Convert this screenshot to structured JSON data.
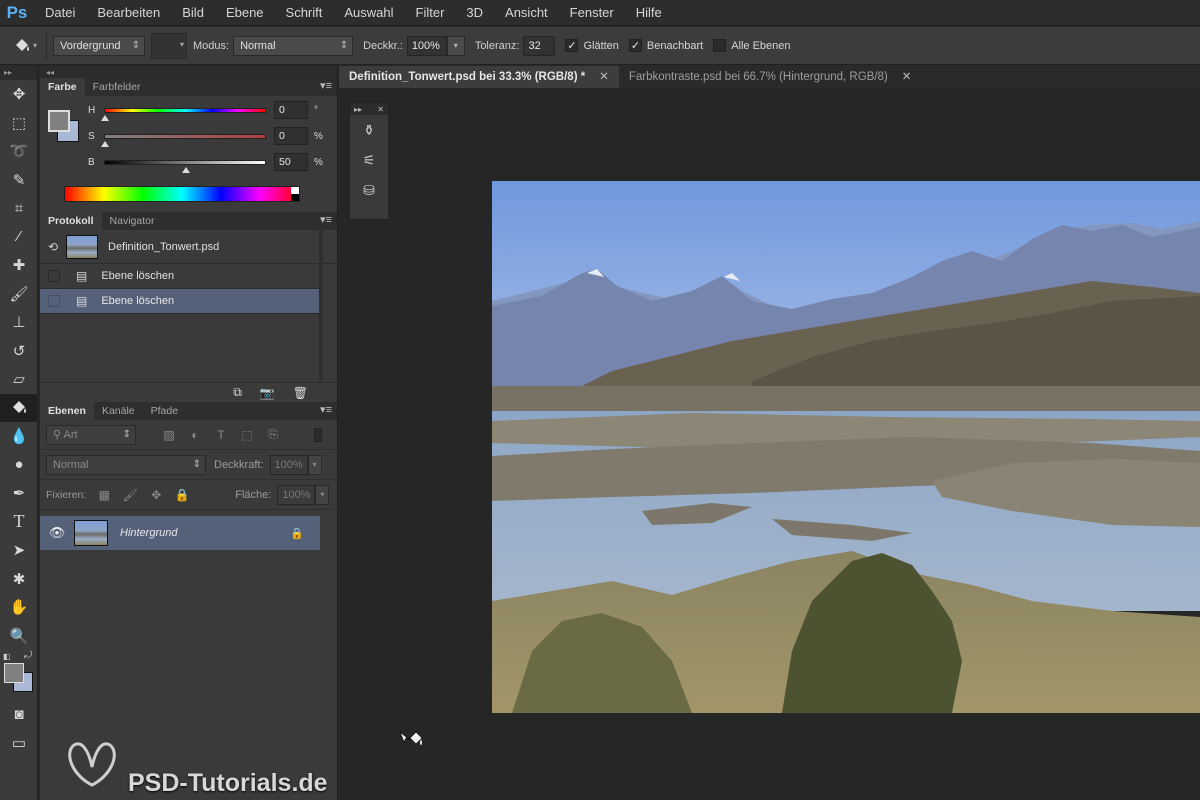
{
  "app": {
    "logo": "Ps"
  },
  "menu": [
    "Datei",
    "Bearbeiten",
    "Bild",
    "Ebene",
    "Schrift",
    "Auswahl",
    "Filter",
    "3D",
    "Ansicht",
    "Fenster",
    "Hilfe"
  ],
  "options": {
    "fill_source": "Vordergrund",
    "mode_label": "Modus:",
    "mode_value": "Normal",
    "opacity_label": "Deckkr.:",
    "opacity_value": "100%",
    "tolerance_label": "Toleranz:",
    "tolerance_value": "32",
    "antialias_label": "Glätten",
    "antialias_checked": true,
    "contiguous_label": "Benachbart",
    "contiguous_checked": true,
    "all_layers_label": "Alle Ebenen",
    "all_layers_checked": false
  },
  "color_panel": {
    "tabs": [
      "Farbe",
      "Farbfelder"
    ],
    "h": {
      "letter": "H",
      "value": "0",
      "unit": "°",
      "level": 0
    },
    "s": {
      "letter": "S",
      "value": "0",
      "unit": "%",
      "level": 0
    },
    "b": {
      "letter": "B",
      "value": "50",
      "unit": "%",
      "level": 0.5
    },
    "foreground_color": "#808080",
    "background_color": "#aab8d6"
  },
  "history_panel": {
    "tabs": [
      "Protokoll",
      "Navigator"
    ],
    "snapshot": "Definition_Tonwert.psd",
    "items": [
      {
        "label": "Ebene löschen",
        "selected": false
      },
      {
        "label": "Ebene löschen",
        "selected": true
      }
    ]
  },
  "layers_panel": {
    "tabs": [
      "Ebenen",
      "Kanäle",
      "Pfade"
    ],
    "filter_kind": "Art",
    "blend_mode": "Normal",
    "opacity_label": "Deckkraft:",
    "opacity_value": "100%",
    "lock_label": "Fixieren:",
    "fill_label": "Fläche:",
    "fill_value": "100%",
    "layers": [
      {
        "name": "Hintergrund",
        "visible": true,
        "locked": true
      }
    ]
  },
  "documents": {
    "tabs": [
      {
        "label": "Definition_Tonwert.psd bei 33.3% (RGB/8) *",
        "active": true
      },
      {
        "label": "Farbkontraste.psd bei 66.7% (Hintergrund, RGB/8)",
        "active": false
      }
    ]
  },
  "watermark": "PSD-Tutorials.de",
  "colors": {
    "accent": "#5ab3f5",
    "selection": "#546179",
    "ui_bg": "#3a3a3a"
  }
}
